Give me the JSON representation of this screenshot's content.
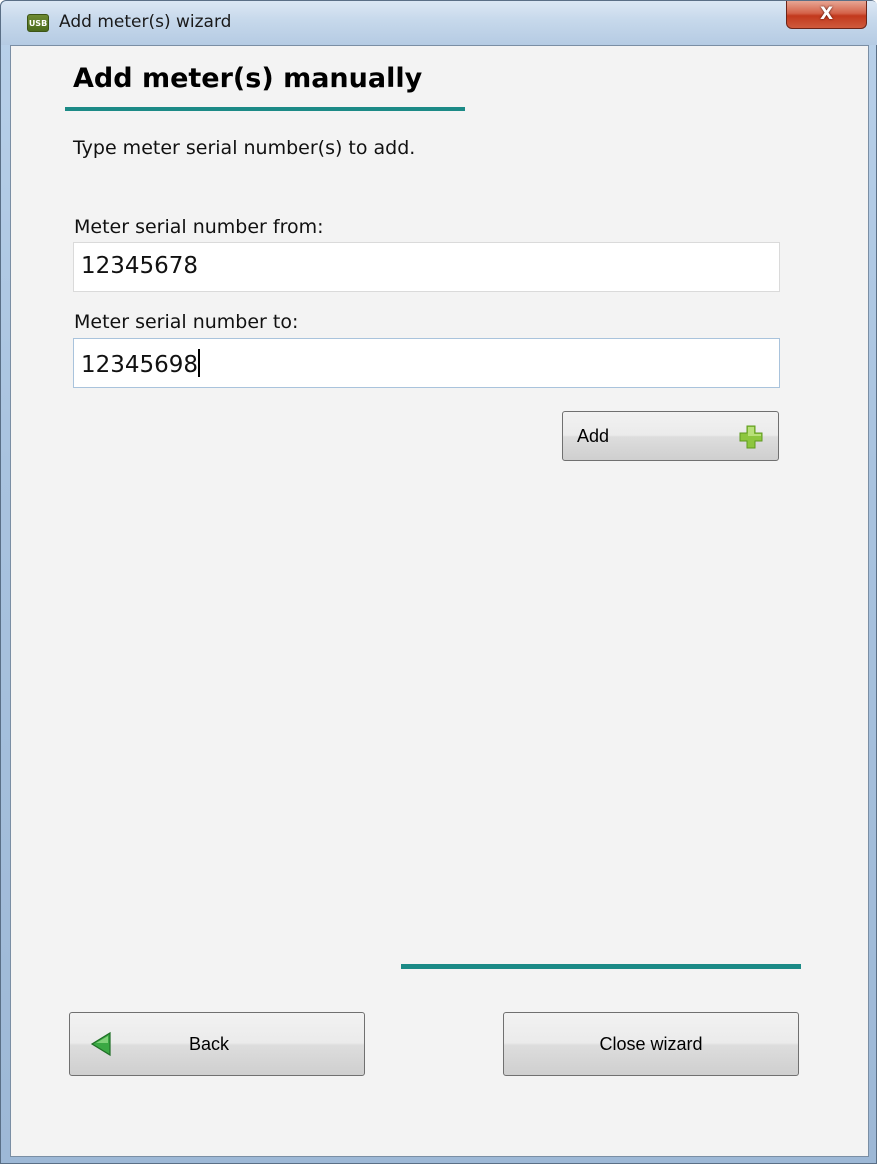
{
  "window": {
    "app_icon_text": "USB",
    "title": "Add meter(s) wizard",
    "close_glyph": "X"
  },
  "page": {
    "heading": "Add meter(s) manually",
    "instruction": "Type meter serial number(s) to add."
  },
  "form": {
    "from_label": "Meter serial number from:",
    "from_value": "12345678",
    "to_label": "Meter serial number to:",
    "to_value": "12345698",
    "add_label": "Add",
    "add_icon": "plus-icon"
  },
  "footer": {
    "back_label": "Back",
    "back_icon": "back-arrow-icon",
    "close_label": "Close wizard"
  },
  "colors": {
    "accent": "#1b8a86",
    "plus_green": "#8dc63f",
    "back_arrow_green": "#3aa843",
    "close_button_red": "#c2391d"
  }
}
